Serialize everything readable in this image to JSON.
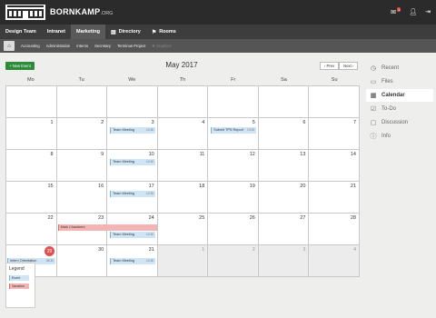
{
  "app": {
    "brand": "BORNKAMP",
    "brand_tld": ".ORG",
    "notifications": "1"
  },
  "nav": {
    "items": [
      {
        "label": "Design Team",
        "icon": ""
      },
      {
        "label": "Intranet",
        "icon": ""
      },
      {
        "label": "Marketing",
        "icon": ""
      },
      {
        "label": "Directory",
        "icon": "book-icon"
      },
      {
        "label": "Rooms",
        "icon": "flag-icon"
      }
    ],
    "active": "Marketing"
  },
  "subnav": {
    "items": [
      "Accounting",
      "Administration",
      "Interns",
      "Secretary",
      "Terminus Project",
      "Graphics"
    ]
  },
  "toolbar": {
    "new_event": "+ New Event",
    "month": "May 2017",
    "prev": "‹ Prev",
    "next": "Next ›"
  },
  "calendar": {
    "weekdays": [
      "Mo",
      "Tu",
      "We",
      "Th",
      "Fr",
      "Sa",
      "Su"
    ],
    "days": [
      "1",
      "2",
      "3",
      "4",
      "5",
      "6",
      "7",
      "8",
      "9",
      "10",
      "11",
      "12",
      "13",
      "14",
      "15",
      "16",
      "17",
      "18",
      "19",
      "20",
      "21",
      "22",
      "23",
      "24",
      "25",
      "26",
      "27",
      "28",
      "29",
      "30",
      "31",
      "1",
      "2",
      "3",
      "4"
    ],
    "today": "29",
    "events": [
      {
        "title": "Team Meeting",
        "time": "14:30"
      },
      {
        "title": "Submit TPS Report",
        "time": "13:00"
      },
      {
        "title": "Team Meeting",
        "time": "14:30"
      },
      {
        "title": "Team Meeting",
        "time": "14:30"
      },
      {
        "title": "Team Meeting",
        "time": "14:30"
      },
      {
        "title": "Intern Orientation",
        "time": "08:30"
      },
      {
        "title": "Team Meeting",
        "time": "14:30"
      }
    ],
    "vacation": {
      "title": "Mark Chambers"
    }
  },
  "legend": {
    "title": "Legend",
    "event": "Event",
    "vacation": "Vacation"
  },
  "side": {
    "items": [
      {
        "label": "Recent",
        "icon": "clock-icon"
      },
      {
        "label": "Files",
        "icon": "folder-icon"
      },
      {
        "label": "Calendar",
        "icon": "calendar-icon"
      },
      {
        "label": "To-Do",
        "icon": "checkbox-icon"
      },
      {
        "label": "Discussion",
        "icon": "chat-icon"
      },
      {
        "label": "Info",
        "icon": "info-icon"
      }
    ],
    "active": "Calendar"
  }
}
